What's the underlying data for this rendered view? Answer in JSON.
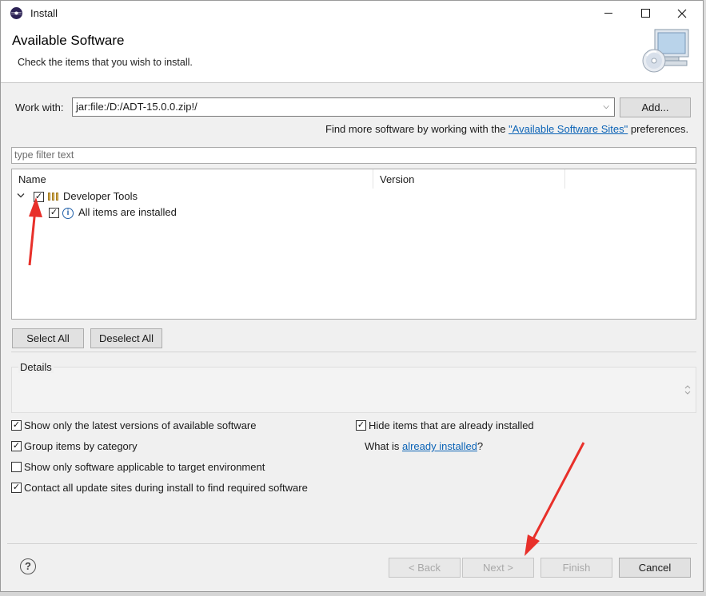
{
  "window": {
    "title": "Install",
    "minimize_icon": "minimize-icon",
    "maximize_icon": "maximize-icon",
    "close_icon": "close-icon"
  },
  "banner": {
    "title": "Available Software",
    "subtitle": "Check the items that you wish to install.",
    "art_icon": "install-cd-monitor-icon"
  },
  "work_with": {
    "label": "Work with:",
    "value": "jar:file:/D:/ADT-15.0.0.zip!/",
    "add_button": "Add...",
    "hint_prefix": "Find more software by working with the",
    "hint_link": "\"Available Software Sites\"",
    "hint_suffix": "preferences."
  },
  "filter": {
    "placeholder": "type filter text"
  },
  "tree": {
    "columns": [
      "Name",
      "Version"
    ],
    "rows": [
      {
        "label": "Developer Tools",
        "checked": true,
        "expanded": true,
        "icon": "package-icon"
      },
      {
        "label": "All items are installed",
        "checked": true,
        "icon": "info-icon"
      }
    ]
  },
  "buttons": {
    "select_all": "Select All",
    "deselect_all": "Deselect All",
    "back": "< Back",
    "next": "Next >",
    "finish": "Finish",
    "cancel": "Cancel"
  },
  "details": {
    "legend": "Details"
  },
  "options": {
    "latest_only": {
      "label": "Show only the latest versions of available software",
      "checked": true
    },
    "group_by_category": {
      "label": "Group items by category",
      "checked": true
    },
    "target_env_only": {
      "label": "Show only software applicable to target environment",
      "checked": false
    },
    "contact_sites": {
      "label": "Contact all update sites during install to find required software",
      "checked": true
    },
    "hide_installed": {
      "label": "Hide items that are already installed",
      "checked": true
    },
    "what_is_prefix": "What is",
    "what_is_link": "already installed",
    "what_is_suffix": "?"
  },
  "colors": {
    "annotation_arrow": "#e8302a",
    "link": "#0b63b6"
  }
}
